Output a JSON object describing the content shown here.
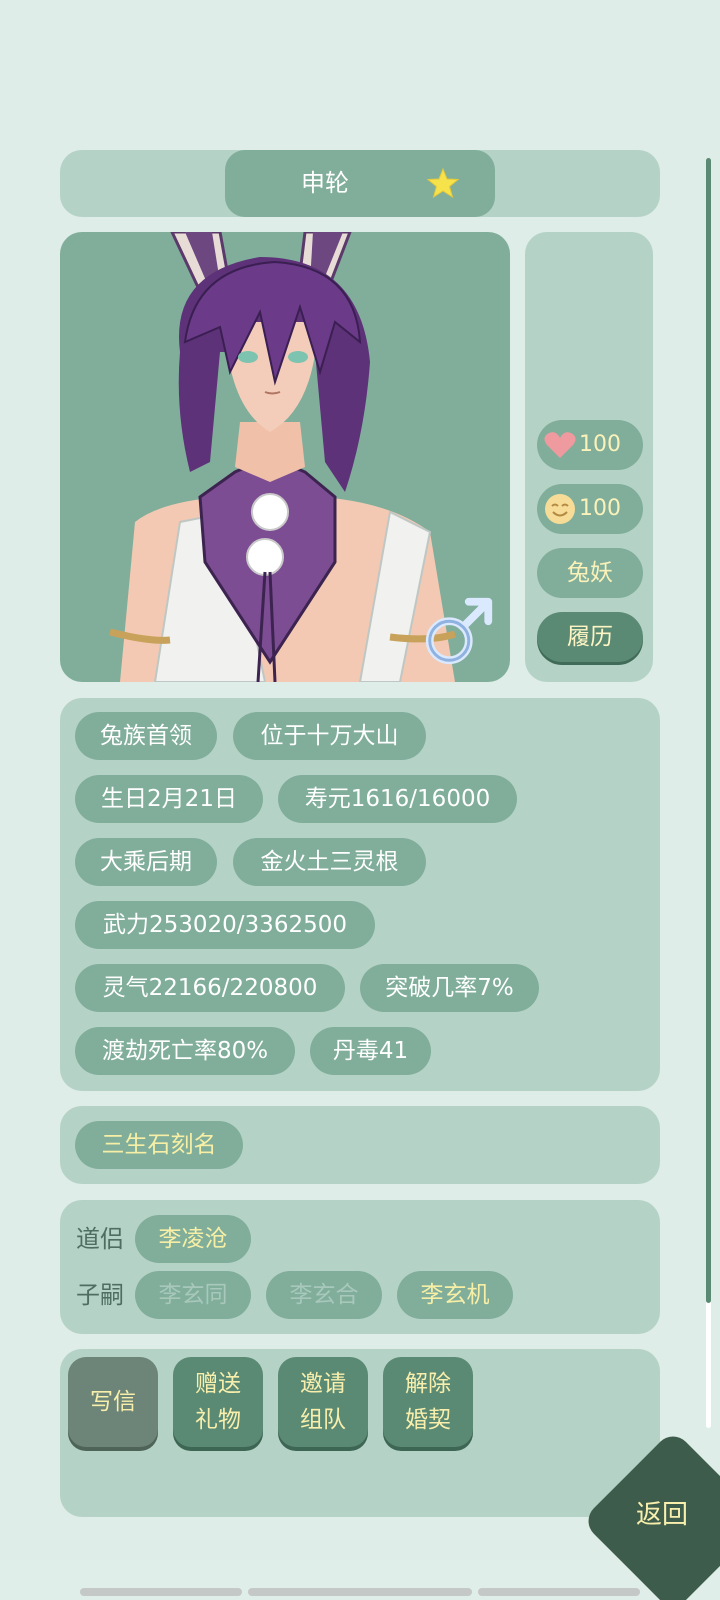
{
  "header": {
    "name": "申轮",
    "star_icon": "star-icon"
  },
  "portrait": {
    "description_icon": "character-portrait",
    "gender_icon": "male-symbol-icon"
  },
  "side": {
    "affection": {
      "icon": "heart-icon",
      "value": "100"
    },
    "mood": {
      "icon": "smile-face-icon",
      "value": "100"
    },
    "race_label": "兔妖",
    "resume_label": "履历"
  },
  "info": {
    "tags": [
      "兔族首领",
      "位于十万大山",
      "生日2月21日",
      "寿元1616/16000",
      "大乘后期",
      "金火土三灵根",
      "武力253020/3362500",
      "灵气22166/220800",
      "突破几率7%",
      "渡劫死亡率80%",
      "丹毒41"
    ]
  },
  "stone": {
    "label": "三生石刻名"
  },
  "relations": {
    "partner_label": "道侣",
    "partner": "李凌沧",
    "children_label": "子嗣",
    "children": [
      "李玄同",
      "李玄合",
      "李玄机"
    ]
  },
  "actions": {
    "write_letter": "写信",
    "send_gift": "赠送\n礼物",
    "invite_team": "邀请\n组队",
    "dissolve_marriage": "解除\n婚契"
  },
  "back_label": "返回",
  "colors": {
    "background": "#deede7",
    "panel": "#b5d2c7",
    "pill": "#80ae9b",
    "button": "#5b8a74",
    "gold_text": "#f7efa6",
    "back_button": "#3e5c4b"
  }
}
